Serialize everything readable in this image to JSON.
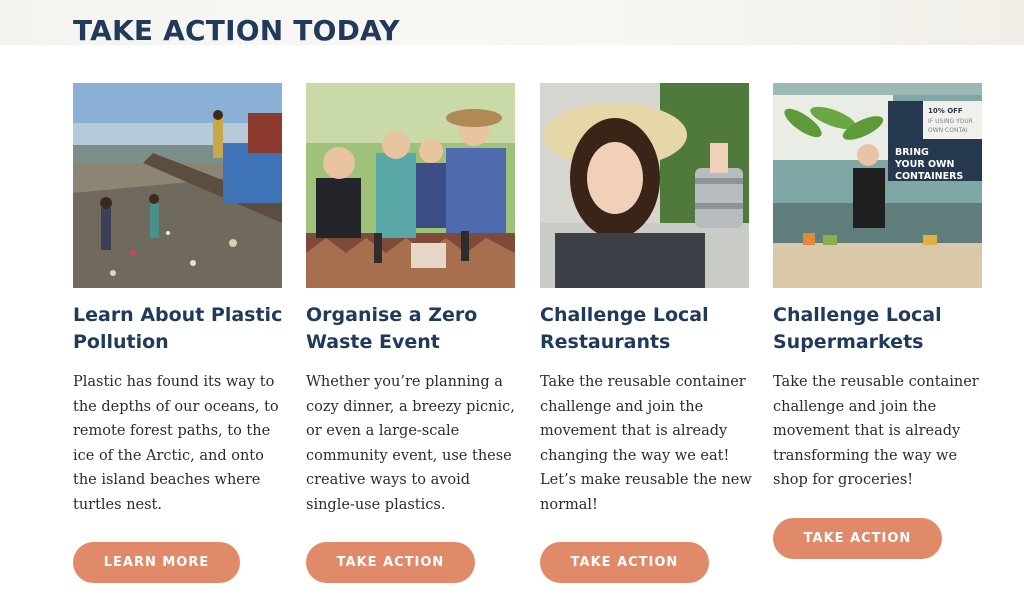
{
  "section": {
    "title": "TAKE ACTION TODAY"
  },
  "cards": [
    {
      "title_line1": "Learn About Plastic",
      "title_line2": "Pollution",
      "text": "Plastic has found its way to the depths of our oceans, to remote forest paths, to the ice of the Arctic, and onto the island beaches where turtles nest.",
      "button": "LEARN MORE",
      "image": "children-polluted-shore-photo"
    },
    {
      "title_line1": "Organise a Zero",
      "title_line2": "Waste Event",
      "text": "Whether you’re planning a cozy dinner, a breezy picnic, or even a large-scale community event, use these creative ways to avoid single-use plastics.",
      "button": "TAKE ACTION",
      "image": "family-picnic-photo"
    },
    {
      "title_line1": "Challenge Local",
      "title_line2": "Restaurants",
      "text": "Take the reusable container challenge and join the movement that is already changing the way we eat! Let’s make reusable the new normal!",
      "button": "TAKE ACTION",
      "image": "woman-holding-tiffin-photo"
    },
    {
      "title_line1": "Challenge Local",
      "title_line2": "Supermarkets",
      "text": "Take the reusable container challenge and join the movement that is already transforming the way we shop for groceries!",
      "button": "TAKE ACTION",
      "image": "supermarket-counter-photo",
      "sign": {
        "offer_line1": "10% OFF",
        "offer_line2": "IF USING YOUR",
        "offer_line3": "OWN CONTAI",
        "line1": "BRING",
        "line2": "YOUR OWN",
        "line3": "CONTAINERS"
      }
    }
  ],
  "colors": {
    "title": "#1f3a5a",
    "button": "#e08a6a",
    "body_text": "#2b2b2b"
  }
}
